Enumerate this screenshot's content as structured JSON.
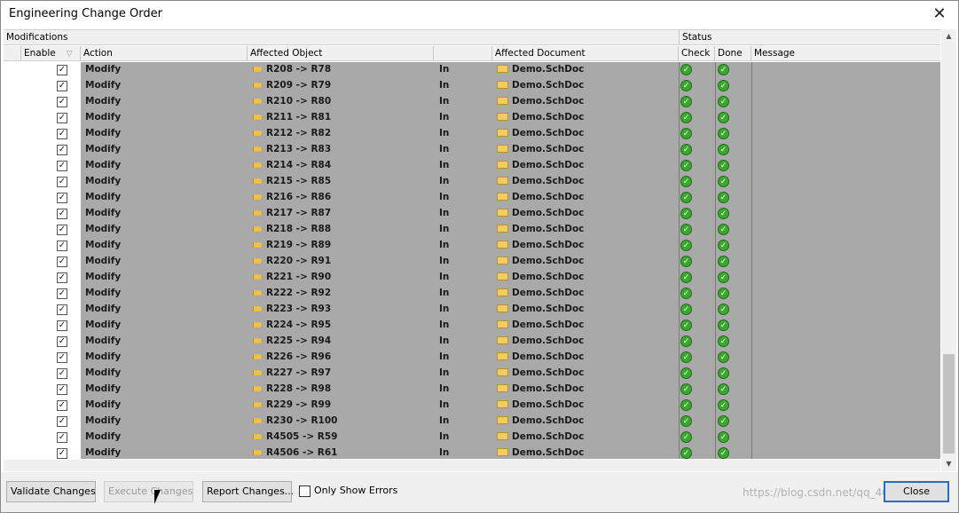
{
  "window": {
    "title": "Engineering Change Order",
    "close_glyph": "✕"
  },
  "header": {
    "group_modifications": "Modifications",
    "group_status": "Status",
    "col_enable": "Enable",
    "col_action": "Action",
    "col_affected_object": "Affected Object",
    "col_affected_document": "Affected Document",
    "col_check": "Check",
    "col_done": "Done",
    "col_message": "Message",
    "sort_indicator": "▽"
  },
  "rows": [
    {
      "action": "Modify",
      "object": "R208 -> R78",
      "in": "In",
      "document": "Demo.SchDoc"
    },
    {
      "action": "Modify",
      "object": "R209 -> R79",
      "in": "In",
      "document": "Demo.SchDoc"
    },
    {
      "action": "Modify",
      "object": "R210 -> R80",
      "in": "In",
      "document": "Demo.SchDoc"
    },
    {
      "action": "Modify",
      "object": "R211 -> R81",
      "in": "In",
      "document": "Demo.SchDoc"
    },
    {
      "action": "Modify",
      "object": "R212 -> R82",
      "in": "In",
      "document": "Demo.SchDoc"
    },
    {
      "action": "Modify",
      "object": "R213 -> R83",
      "in": "In",
      "document": "Demo.SchDoc"
    },
    {
      "action": "Modify",
      "object": "R214 -> R84",
      "in": "In",
      "document": "Demo.SchDoc"
    },
    {
      "action": "Modify",
      "object": "R215 -> R85",
      "in": "In",
      "document": "Demo.SchDoc"
    },
    {
      "action": "Modify",
      "object": "R216 -> R86",
      "in": "In",
      "document": "Demo.SchDoc"
    },
    {
      "action": "Modify",
      "object": "R217 -> R87",
      "in": "In",
      "document": "Demo.SchDoc"
    },
    {
      "action": "Modify",
      "object": "R218 -> R88",
      "in": "In",
      "document": "Demo.SchDoc"
    },
    {
      "action": "Modify",
      "object": "R219 -> R89",
      "in": "In",
      "document": "Demo.SchDoc"
    },
    {
      "action": "Modify",
      "object": "R220 -> R91",
      "in": "In",
      "document": "Demo.SchDoc"
    },
    {
      "action": "Modify",
      "object": "R221 -> R90",
      "in": "In",
      "document": "Demo.SchDoc"
    },
    {
      "action": "Modify",
      "object": "R222 -> R92",
      "in": "In",
      "document": "Demo.SchDoc"
    },
    {
      "action": "Modify",
      "object": "R223 -> R93",
      "in": "In",
      "document": "Demo.SchDoc"
    },
    {
      "action": "Modify",
      "object": "R224 -> R95",
      "in": "In",
      "document": "Demo.SchDoc"
    },
    {
      "action": "Modify",
      "object": "R225 -> R94",
      "in": "In",
      "document": "Demo.SchDoc"
    },
    {
      "action": "Modify",
      "object": "R226 -> R96",
      "in": "In",
      "document": "Demo.SchDoc"
    },
    {
      "action": "Modify",
      "object": "R227 -> R97",
      "in": "In",
      "document": "Demo.SchDoc"
    },
    {
      "action": "Modify",
      "object": "R228 -> R98",
      "in": "In",
      "document": "Demo.SchDoc"
    },
    {
      "action": "Modify",
      "object": "R229 -> R99",
      "in": "In",
      "document": "Demo.SchDoc"
    },
    {
      "action": "Modify",
      "object": "R230 -> R100",
      "in": "In",
      "document": "Demo.SchDoc"
    },
    {
      "action": "Modify",
      "object": "R4505 -> R59",
      "in": "In",
      "document": "Demo.SchDoc"
    },
    {
      "action": "Modify",
      "object": "R4506 -> R61",
      "in": "In",
      "document": "Demo.SchDoc"
    }
  ],
  "row_icons": {
    "check": "check-ok-icon",
    "done": "done-ok-icon",
    "object": "arrow-icon",
    "document": "schdoc-icon"
  },
  "buttons": {
    "validate": "Validate Changes",
    "execute": "Execute Changes",
    "report": "Report Changes...",
    "close": "Close"
  },
  "only_show_errors": {
    "label": "Only Show Errors",
    "checked": false
  },
  "watermark": "https://blog.csdn.net/qq_40550681",
  "colors": {
    "row_highlight": "#a9a9a9",
    "status_ok": "#3aa82c",
    "focus_border": "#1f6fd0"
  }
}
